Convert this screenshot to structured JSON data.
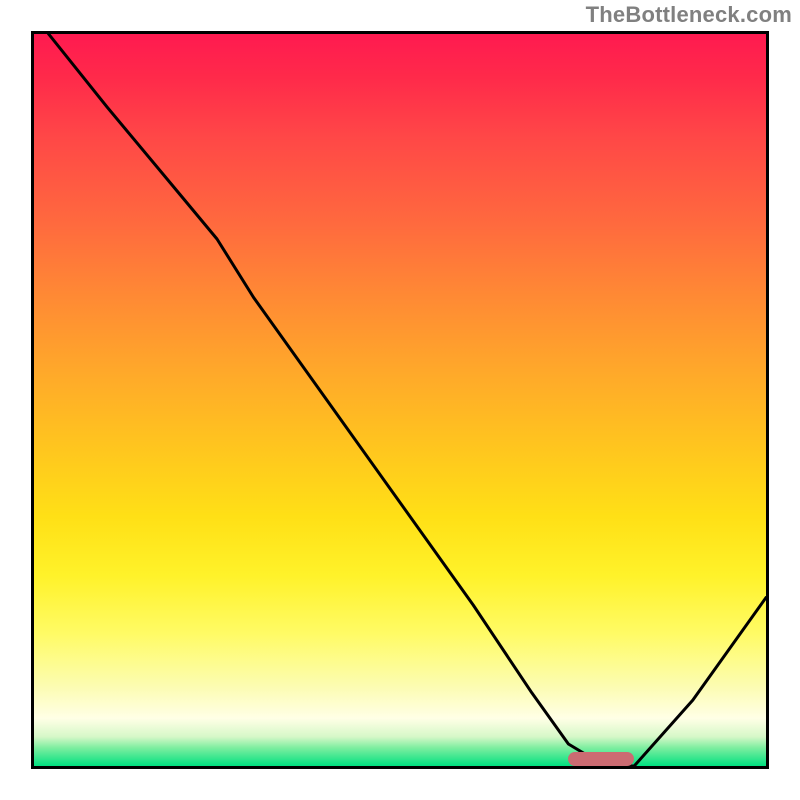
{
  "watermark": "TheBottleneck.com",
  "chart_data": {
    "type": "line",
    "title": "",
    "xlabel": "",
    "ylabel": "",
    "xlim": [
      0,
      100
    ],
    "ylim": [
      0,
      100
    ],
    "grid": false,
    "legend": false,
    "x": [
      2,
      10,
      20,
      25,
      30,
      40,
      50,
      60,
      68,
      73,
      78,
      82,
      90,
      100
    ],
    "y": [
      100,
      90,
      78,
      72,
      64,
      50,
      36,
      22,
      10,
      3,
      0,
      0,
      9,
      23
    ],
    "gradient_stops": [
      {
        "pos": 0.0,
        "color": "#ff1a50"
      },
      {
        "pos": 0.5,
        "color": "#ffc020"
      },
      {
        "pos": 0.8,
        "color": "#fff85a"
      },
      {
        "pos": 0.94,
        "color": "#ffffe6"
      },
      {
        "pos": 1.0,
        "color": "#00e080"
      }
    ],
    "annotations": [
      {
        "type": "marker",
        "shape": "pill",
        "x_start": 73,
        "x_end": 82,
        "y": 1,
        "color": "#cc6b72"
      }
    ]
  }
}
